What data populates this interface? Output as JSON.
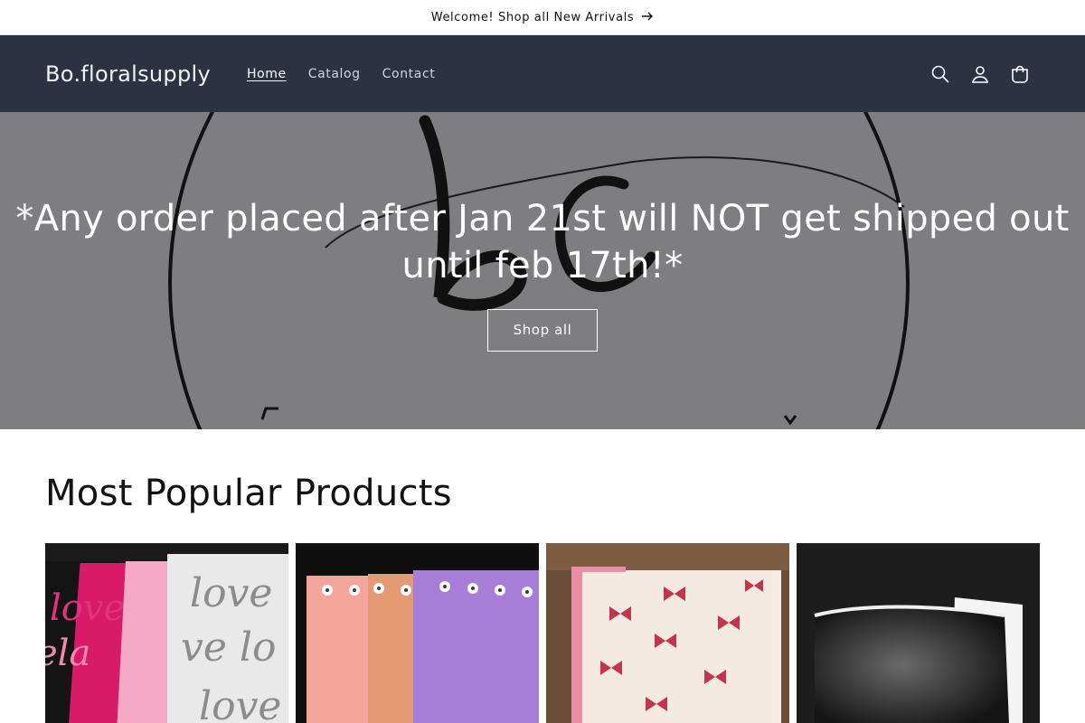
{
  "announcement": {
    "text": "Welcome! Shop all New Arrivals",
    "icon": "arrow-right-icon"
  },
  "header": {
    "brand": "Bo.floralsupply",
    "nav": [
      {
        "label": "Home",
        "active": true
      },
      {
        "label": "Catalog",
        "active": false
      },
      {
        "label": "Contact",
        "active": false
      }
    ],
    "icons": [
      "search-icon",
      "account-icon",
      "cart-icon"
    ],
    "background": "#2b3242"
  },
  "hero": {
    "heading": "*Any order placed after Jan 21st will NOT get shipped out until feb 17th!*",
    "button": "Shop all",
    "logo_letters": "bo"
  },
  "featured": {
    "title": "Most Popular Products",
    "products": [
      {
        "image": "love script wrapping paper in black, pink and grey"
      },
      {
        "image": "pastel wrapping paper with daisy trim"
      },
      {
        "image": "cream wrapping paper with pink bows"
      },
      {
        "image": "black and white wrapping paper"
      }
    ]
  }
}
